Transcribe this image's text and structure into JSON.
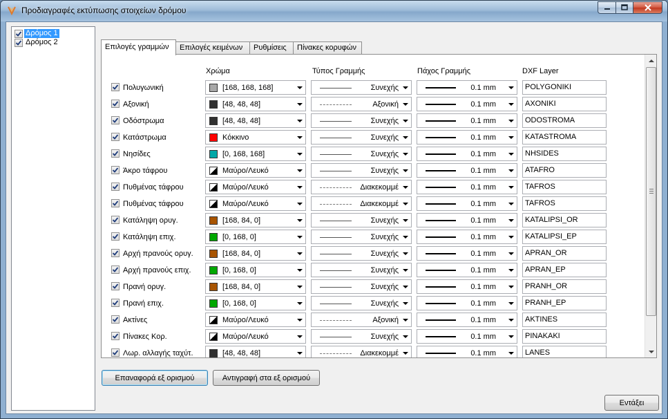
{
  "window": {
    "title": "Προδιαγραφές εκτύπωσης στοιχείων δρόμου"
  },
  "tree": {
    "items": [
      {
        "label": "Δρόμος 1",
        "checked": true,
        "selected": true
      },
      {
        "label": "Δρόμος 2",
        "checked": true,
        "selected": false
      }
    ]
  },
  "tabs": [
    {
      "label": "Επιλογές γραμμών",
      "active": true
    },
    {
      "label": "Επιλογές κειμένων",
      "active": false
    },
    {
      "label": "Ρυθμίσεις",
      "active": false
    },
    {
      "label": "Πίνακες κορυφών",
      "active": false
    }
  ],
  "headers": {
    "color": "Χρώμα",
    "line_type": "Τύπος Γραμμής",
    "line_width": "Πάχος Γραμμής",
    "dxf_layer": "DXF Layer"
  },
  "rows": [
    {
      "label": "Πολυγωνική",
      "checked": true,
      "color_text": "[168, 168, 168]",
      "swatch": "#a8a8a8",
      "line_type": "Συνεχής",
      "lt_style": "solid",
      "width": "0.1 mm",
      "layer": "POLYGONIKI"
    },
    {
      "label": "Αξονική",
      "checked": true,
      "color_text": "[48, 48, 48]",
      "swatch": "#303030",
      "line_type": "Αξονική",
      "lt_style": "dashdot",
      "width": "0.1 mm",
      "layer": "AXONIKI"
    },
    {
      "label": "Οδόστρωμα",
      "checked": true,
      "color_text": "[48, 48, 48]",
      "swatch": "#303030",
      "line_type": "Συνεχής",
      "lt_style": "solid",
      "width": "0.1 mm",
      "layer": "ODOSTROMA"
    },
    {
      "label": "Κατάστρωμα",
      "checked": true,
      "color_text": "Κόκκινο",
      "swatch": "#ff0000",
      "line_type": "Συνεχής",
      "lt_style": "solid",
      "width": "0.1 mm",
      "layer": "KATASTROMA"
    },
    {
      "label": "Νησίδες",
      "checked": true,
      "color_text": "[0, 168, 168]",
      "swatch": "#00a8a8",
      "line_type": "Συνεχής",
      "lt_style": "solid",
      "width": "0.1 mm",
      "layer": "NHSIDES"
    },
    {
      "label": "Άκρο τάφρου",
      "checked": true,
      "color_text": "Μαύρο/Λευκό",
      "swatch": "bw",
      "line_type": "Συνεχής",
      "lt_style": "solid",
      "width": "0.1 mm",
      "layer": "ATAFRO"
    },
    {
      "label": "Πυθμένας τάφρου",
      "checked": true,
      "color_text": "Μαύρο/Λευκό",
      "swatch": "bw",
      "line_type": "Διακεκομμέ",
      "lt_style": "dashed",
      "width": "0.1 mm",
      "layer": "TAFROS"
    },
    {
      "label": "Πυθμένας τάφρου",
      "checked": true,
      "color_text": "Μαύρο/Λευκό",
      "swatch": "bw",
      "line_type": "Διακεκομμέ",
      "lt_style": "dashed",
      "width": "0.1 mm",
      "layer": "TAFROS"
    },
    {
      "label": "Κατάληψη ορυγ.",
      "checked": true,
      "color_text": "[168, 84, 0]",
      "swatch": "#a85400",
      "line_type": "Συνεχής",
      "lt_style": "solid",
      "width": "0.1 mm",
      "layer": "KATALIPSI_OR"
    },
    {
      "label": "Κατάληψη επιχ.",
      "checked": true,
      "color_text": "[0, 168, 0]",
      "swatch": "#00a800",
      "line_type": "Συνεχής",
      "lt_style": "solid",
      "width": "0.1 mm",
      "layer": "KATALIPSI_EP"
    },
    {
      "label": "Αρχή πρανούς ορυγ.",
      "checked": true,
      "color_text": "[168, 84, 0]",
      "swatch": "#a85400",
      "line_type": "Συνεχής",
      "lt_style": "solid",
      "width": "0.1 mm",
      "layer": "APRAN_OR"
    },
    {
      "label": "Αρχή πρανούς επιχ.",
      "checked": true,
      "color_text": "[0, 168, 0]",
      "swatch": "#00a800",
      "line_type": "Συνεχής",
      "lt_style": "solid",
      "width": "0.1 mm",
      "layer": "APRAN_EP"
    },
    {
      "label": "Πρανή ορυγ.",
      "checked": true,
      "color_text": "[168, 84, 0]",
      "swatch": "#a85400",
      "line_type": "Συνεχής",
      "lt_style": "solid",
      "width": "0.1 mm",
      "layer": "PRANH_OR"
    },
    {
      "label": "Πρανή επιχ.",
      "checked": true,
      "color_text": "[0, 168, 0]",
      "swatch": "#00a800",
      "line_type": "Συνεχής",
      "lt_style": "solid",
      "width": "0.1 mm",
      "layer": "PRANH_EP"
    },
    {
      "label": "Ακτίνες",
      "checked": true,
      "color_text": "Μαύρο/Λευκό",
      "swatch": "bw",
      "line_type": "Αξονική",
      "lt_style": "dashdot",
      "width": "0.1 mm",
      "layer": "AKTINES"
    },
    {
      "label": "Πίνακες Κορ.",
      "checked": true,
      "color_text": "Μαύρο/Λευκό",
      "swatch": "bw",
      "line_type": "Συνεχής",
      "lt_style": "solid",
      "width": "0.1 mm",
      "layer": "PINAKAKI"
    },
    {
      "label": "Λωρ. αλλαγής ταχύτ.",
      "checked": true,
      "color_text": "[48, 48, 48]",
      "swatch": "#303030",
      "line_type": "Διακεκομμέ",
      "lt_style": "dashed",
      "width": "0.1 mm",
      "layer": "LANES"
    }
  ],
  "buttons": {
    "reset": "Επαναφορά εξ ορισμού",
    "copy": "Αντιγραφή στα εξ ορισμού",
    "ok": "Εντάξει"
  }
}
